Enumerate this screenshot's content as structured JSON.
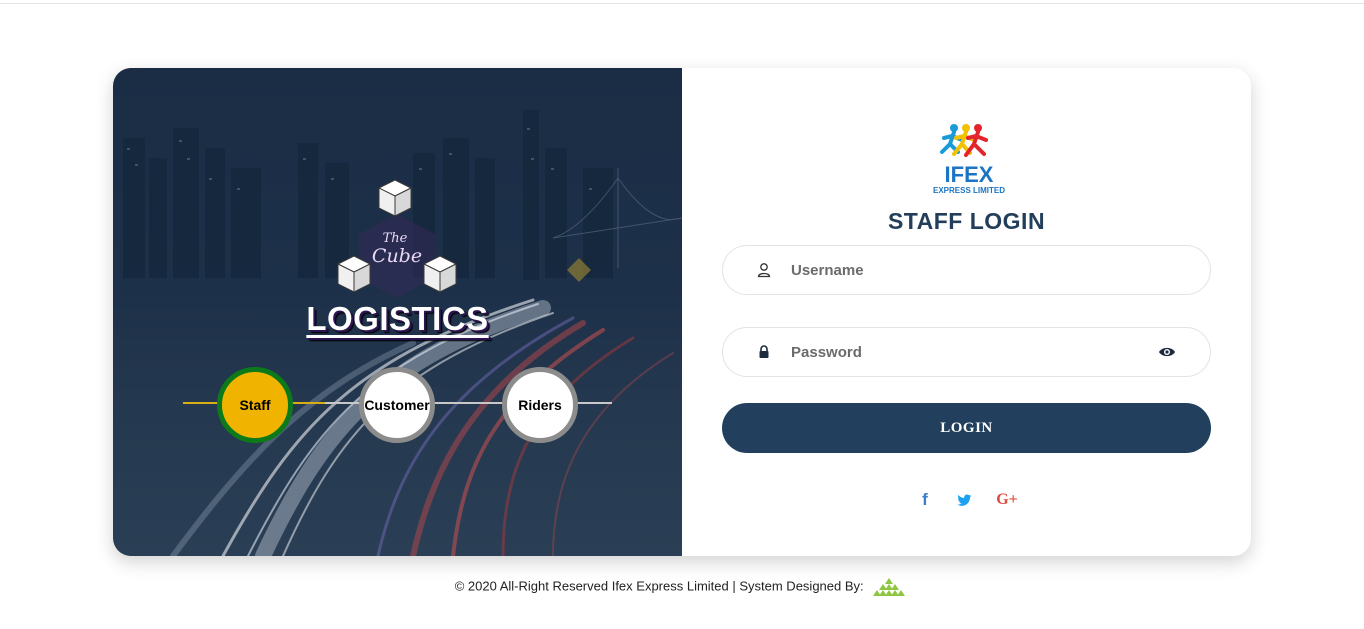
{
  "left_panel": {
    "brand_script": {
      "line1": "The",
      "line2": "Cube"
    },
    "brand_title": "LOGISTICS",
    "steps": [
      {
        "label": "Staff",
        "active": true
      },
      {
        "label": "Customer",
        "active": false
      },
      {
        "label": "Riders",
        "active": false
      }
    ],
    "colors": {
      "active_fill": "#f0b400",
      "active_ring": "#0d7a1a",
      "inactive_ring": "#8c8c8c",
      "track_active": "#d8ae14",
      "track_inactive": "#c8c8c8"
    }
  },
  "right_panel": {
    "logo": {
      "word": "IFEX",
      "tagline": "EXPRESS LIMITED"
    },
    "title": "STAFF LOGIN",
    "username": {
      "placeholder": "Username",
      "value": "",
      "icon": "user-icon"
    },
    "password": {
      "placeholder": "Password",
      "value": "",
      "icon": "lock-icon",
      "toggle_icon": "eye-icon"
    },
    "login_label": "LOGIN",
    "social": [
      {
        "name": "facebook-icon",
        "glyph": "f",
        "color": "#3b7bd4"
      },
      {
        "name": "twitter-icon",
        "glyph": "twitter",
        "color": "#1da1f2"
      },
      {
        "name": "google-plus-icon",
        "glyph": "G+",
        "color": "#dd4b39"
      }
    ],
    "colors": {
      "primary": "#22405d",
      "title": "#233e5a"
    }
  },
  "footer": {
    "text": "© 2020 All-Right Reserved Ifex Express Limited | System Designed By:"
  }
}
